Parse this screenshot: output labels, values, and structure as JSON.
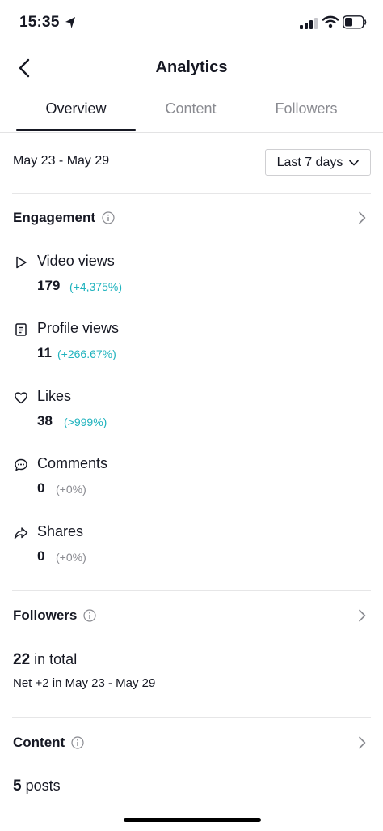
{
  "status": {
    "time": "15:35"
  },
  "nav": {
    "title": "Analytics"
  },
  "tabs": [
    {
      "label": "Overview",
      "active": true
    },
    {
      "label": "Content",
      "active": false
    },
    {
      "label": "Followers",
      "active": false
    }
  ],
  "date_range": "May 23 - May 29",
  "range_select": {
    "value": "Last 7 days"
  },
  "engagement": {
    "title": "Engagement",
    "metrics": [
      {
        "label": "Video views",
        "value": "179",
        "change": "(+4,375%)",
        "icon": "play-icon"
      },
      {
        "label": "Profile views",
        "value": "11",
        "change": "(+266.67%)",
        "icon": "document-icon"
      },
      {
        "label": "Likes",
        "value": "38",
        "change": "(>999%)",
        "icon": "heart-icon"
      },
      {
        "label": "Comments",
        "value": "0",
        "change": "(+0%)",
        "icon": "comment-icon"
      },
      {
        "label": "Shares",
        "value": "0",
        "change": "(+0%)",
        "icon": "share-icon"
      }
    ]
  },
  "followers": {
    "title": "Followers",
    "total_value": "22",
    "total_suffix": "in total",
    "net": "Net +2 in May 23 - May 29"
  },
  "content": {
    "title": "Content",
    "posts_value": "5",
    "posts_suffix": "posts"
  },
  "colors": {
    "accent_teal": "#20b3be",
    "text_primary": "#161823",
    "text_muted": "#8a8b91"
  }
}
